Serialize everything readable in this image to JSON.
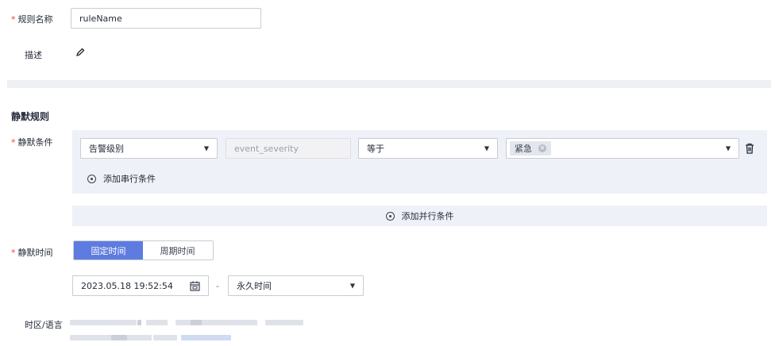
{
  "rule_name": {
    "label": "规则名称",
    "value": "ruleName"
  },
  "description": {
    "label": "描述",
    "icon": "pencil-icon"
  },
  "section_title": "静默规则",
  "silence_condition": {
    "label": "静默条件",
    "field_select": "告警级别",
    "field_key": "event_severity",
    "operator_select": "等于",
    "value_tags": [
      "紧急"
    ],
    "add_serial_label": "添加串行条件",
    "add_parallel_label": "添加并行条件"
  },
  "silence_time": {
    "label": "静默时间",
    "tabs": [
      {
        "label": "固定时间",
        "active": true
      },
      {
        "label": "周期时间",
        "active": false
      }
    ],
    "start_datetime": "2023.05.18 19:52:54",
    "separator": "-",
    "end_select": "永久时间"
  },
  "timezone": {
    "label": "时区/语言"
  },
  "colors": {
    "accent": "#5e7ce0",
    "required": "#e54545",
    "panel": "#eef1f7"
  }
}
